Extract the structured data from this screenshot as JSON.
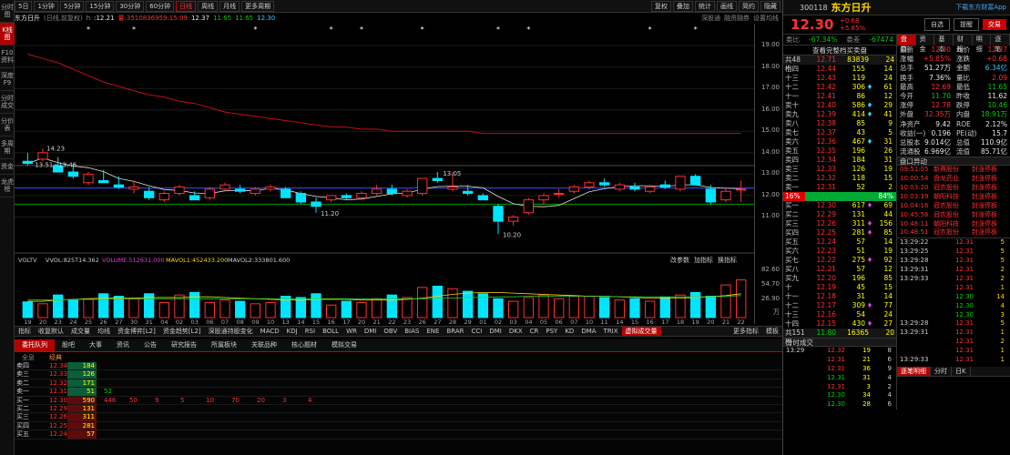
{
  "left_nav": [
    "分时图",
    "K线图",
    "F10资料",
    "深度F9",
    "分时成交",
    "分价表",
    "多周期",
    "资金",
    "龙虎榜"
  ],
  "left_nav_active": 1,
  "toolbar": {
    "periods": [
      "5日",
      "1分钟",
      "5分钟",
      "15分钟",
      "30分钟",
      "60分钟",
      "日线",
      "周线",
      "月线",
      "更多周期"
    ],
    "active": "日线",
    "right": [
      "复权",
      "叠加",
      "统计",
      "画线",
      "简约",
      "隐藏"
    ]
  },
  "info": {
    "name": "东方日升",
    "mode": "(日线,前复权)",
    "h": "h",
    "cursor": ":12.21",
    "vol": "量:3510836959:15:09",
    "c1": "12.37",
    "c2": "11.65",
    "c3": "11.65",
    "c4": "12.30",
    "links": [
      "深股通",
      "融资融券",
      "设置均线"
    ]
  },
  "price_axis": [
    "19.00",
    "18.00",
    "17.00",
    "16.00",
    "15.00",
    "14.00",
    "13.00",
    "12.00",
    "11.00"
  ],
  "vol_axis": [
    "82.60",
    "54.70",
    "26.90",
    "万"
  ],
  "chart_labels": {
    "max": "14.23",
    "ma_range": "13.51~13.46",
    "high2": "13.05",
    "low1": "11.20",
    "low2": "10.20"
  },
  "vol_header": {
    "a": "VOLTV",
    "b": "VVOL:825T14.362",
    "c": "VOLUME:512631.000",
    "d": "MAVOL1:452433.200",
    "e": "MAVOL2:333801.600",
    "right": [
      "改参数",
      "加指标",
      "换指标"
    ]
  },
  "date_ticks": [
    "19",
    "20",
    "23",
    "24",
    "25",
    "26",
    "27",
    "30",
    "31",
    "04",
    "02",
    "03",
    "06",
    "07",
    "08",
    "09",
    "10",
    "13",
    "14",
    "15",
    "16",
    "17",
    "20",
    "21",
    "22",
    "23",
    "26",
    "27",
    "28",
    "29",
    "01",
    "02",
    "03",
    "04",
    "05",
    "06",
    "07",
    "10",
    "11",
    "14",
    "15",
    "16",
    "17",
    "18",
    "19",
    "20",
    "21",
    "22"
  ],
  "indicators": [
    "指标",
    "收复默认",
    "成交量",
    "均线",
    "资金博弈[L2]",
    "资金趋势[L2]",
    "深股通持股变化",
    "MACD",
    "KDJ",
    "RSI",
    "BOLL",
    "WR",
    "DMI",
    "OBV",
    "BIAS",
    "ENE",
    "BRAR",
    "CCI",
    "DMI",
    "DKX",
    "CR",
    "PSY",
    "KD",
    "DMA",
    "TRIX",
    "虚拟成交量",
    "更多指标",
    "模板"
  ],
  "indicators_active": "虚拟成交量",
  "bottom_tabs": [
    "委托队列",
    "股吧",
    "大事",
    "资讯",
    "公告",
    "研究报告",
    "所属板块",
    "关联品种",
    "核心题材",
    "模拟交易"
  ],
  "queue_head": {
    "a": "全息",
    "b": "经典"
  },
  "queue": [
    {
      "l": "卖四",
      "p": "12.34",
      "v": "184",
      "c": "red",
      "o": []
    },
    {
      "l": "卖三",
      "p": "12.33",
      "v": "126",
      "c": "red",
      "o": []
    },
    {
      "l": "卖二",
      "p": "12.32",
      "v": "171",
      "c": "red",
      "o": []
    },
    {
      "l": "卖一",
      "p": "12.31",
      "v": "51",
      "c": "red",
      "o": [
        "52"
      ]
    },
    {
      "l": "买一",
      "p": "12.30",
      "v": "590",
      "c": "red",
      "o": [
        "446",
        "50",
        "9",
        "5",
        "10",
        "70",
        "20",
        "3",
        "4"
      ]
    },
    {
      "l": "买二",
      "p": "12.29",
      "v": "131",
      "c": "red",
      "o": []
    },
    {
      "l": "买三",
      "p": "12.26",
      "v": "311",
      "c": "red",
      "o": []
    },
    {
      "l": "买四",
      "p": "12.25",
      "v": "281",
      "c": "red",
      "o": []
    },
    {
      "l": "买五",
      "p": "12.24",
      "v": "57",
      "c": "red",
      "o": []
    }
  ],
  "stock": {
    "code": "300118",
    "name": "东方日升",
    "price": "12.30",
    "chg": "+0.68",
    "pct": "+5.85%",
    "btn1": "自选",
    "btn2": "提醒",
    "btn3": "交易",
    "ad": "下载东方财富App"
  },
  "weibi": {
    "k1": "委比",
    "v1": "-67.34%",
    "k2": "委差",
    "v2": "-67474"
  },
  "rtabs1": [
    "盘口",
    "资金",
    "基本",
    "财报",
    "明细",
    "逐笔"
  ],
  "orderbook_head": {
    "a": "查看完整档买卖盘",
    "b": "共48档",
    "c": "12.71",
    "d": "83839",
    "e": "24"
  },
  "asks": [
    {
      "l": "十四",
      "p": "12.44",
      "v": "155",
      "f": "",
      "n": "14"
    },
    {
      "l": "十三",
      "p": "12.43",
      "v": "119",
      "f": "",
      "n": "24"
    },
    {
      "l": "十二",
      "p": "12.42",
      "v": "306",
      "f": "♦",
      "n": "61"
    },
    {
      "l": "十一",
      "p": "12.41",
      "v": "86",
      "f": "",
      "n": "12"
    },
    {
      "l": "卖十",
      "p": "12.40",
      "v": "586",
      "f": "♦",
      "n": "29"
    },
    {
      "l": "卖九",
      "p": "12.39",
      "v": "414",
      "f": "♦",
      "n": "41"
    },
    {
      "l": "卖八",
      "p": "12.38",
      "v": "85",
      "f": "",
      "n": "9"
    },
    {
      "l": "卖七",
      "p": "12.37",
      "v": "43",
      "f": "",
      "n": "5"
    },
    {
      "l": "卖六",
      "p": "12.36",
      "v": "467",
      "f": "♦",
      "n": "31"
    },
    {
      "l": "卖五",
      "p": "12.35",
      "v": "196",
      "f": "",
      "n": "26"
    },
    {
      "l": "卖四",
      "p": "12.34",
      "v": "184",
      "f": "",
      "n": "31"
    },
    {
      "l": "卖三",
      "p": "12.33",
      "v": "126",
      "f": "",
      "n": "19"
    },
    {
      "l": "卖二",
      "p": "12.32",
      "v": "118",
      "f": "",
      "n": "15"
    },
    {
      "l": "卖一",
      "p": "12.31",
      "v": "52",
      "f": "",
      "n": "2"
    }
  ],
  "mid": {
    "pct": "16%",
    "label": "",
    "pct2": "84%"
  },
  "bids": [
    {
      "l": "买一",
      "p": "12.30",
      "v": "617",
      "f": "♦",
      "n": "69"
    },
    {
      "l": "买二",
      "p": "12.29",
      "v": "131",
      "f": "",
      "n": "44"
    },
    {
      "l": "买三",
      "p": "12.26",
      "v": "311",
      "f": "♦",
      "n": "156"
    },
    {
      "l": "买四",
      "p": "12.25",
      "v": "281",
      "f": "♦",
      "n": "85"
    },
    {
      "l": "买五",
      "p": "12.24",
      "v": "57",
      "f": "",
      "n": "14"
    },
    {
      "l": "买六",
      "p": "12.23",
      "v": "51",
      "f": "",
      "n": "19"
    },
    {
      "l": "买七",
      "p": "12.22",
      "v": "275",
      "f": "♦",
      "n": "92"
    },
    {
      "l": "买八",
      "p": "12.21",
      "v": "57",
      "f": "",
      "n": "12"
    },
    {
      "l": "买九",
      "p": "12.20",
      "v": "196",
      "f": "",
      "n": "85"
    },
    {
      "l": "十",
      "p": "12.19",
      "v": "45",
      "f": "",
      "n": "15"
    },
    {
      "l": "十一",
      "p": "12.18",
      "v": "31",
      "f": "",
      "n": "14"
    },
    {
      "l": "十二",
      "p": "12.17",
      "v": "309",
      "f": "♦",
      "n": "77"
    },
    {
      "l": "十三",
      "p": "12.16",
      "v": "54",
      "f": "",
      "n": "24"
    },
    {
      "l": "十四",
      "p": "12.15",
      "v": "430",
      "f": "♦",
      "n": "27"
    }
  ],
  "orderbook_foot": {
    "a": "共151档",
    "b": "11.80",
    "c": "16365",
    "d": "20"
  },
  "stats": [
    [
      "最新",
      "12.30",
      "red",
      "均价",
      "12.37",
      "red"
    ],
    [
      "涨幅",
      "+5.85%",
      "red",
      "涨跌",
      "+0.68",
      "red"
    ],
    [
      "总手",
      "51.27万",
      "wht",
      "金额",
      "6.34亿",
      "cyan"
    ],
    [
      "换手",
      "7.36%",
      "wht",
      "量比",
      "2.09",
      "red"
    ],
    [
      "最高",
      "12.69",
      "red",
      "最低",
      "11.65",
      "grn"
    ],
    [
      "今开",
      "11.70",
      "grn",
      "昨收",
      "11.62",
      "wht"
    ],
    [
      "涨停",
      "12.78",
      "red",
      "跌停",
      "10.46",
      "grn"
    ],
    [
      "外盘",
      "32.35万",
      "red",
      "内盘",
      "18.91万",
      "grn"
    ],
    [
      "净资产",
      "9.42",
      "wht",
      "ROE",
      "2.12%",
      "wht"
    ],
    [
      "收益(一)",
      "0.196",
      "wht",
      "PE(动)",
      "15.7",
      "wht"
    ],
    [
      "总股本",
      "9.014亿",
      "wht",
      "总值",
      "110.9亿",
      "wht"
    ],
    [
      "流通股",
      "6.969亿",
      "wht",
      "流值",
      "85.71亿",
      "wht"
    ]
  ],
  "movers_title": "盘口异动",
  "movers": [
    [
      "09:51:05",
      "新赛股份",
      "封涨停板"
    ],
    [
      "10:00:54",
      "盘龙药业",
      "封涨停板"
    ],
    [
      "10:03:20",
      "冠农股份",
      "封涨停板"
    ],
    [
      "10:03:39",
      "朝阳科技",
      "封涨停板"
    ],
    [
      "10:04:16",
      "冠农股份",
      "封涨停板"
    ],
    [
      "10:45:56",
      "冠农股份",
      "封涨停板"
    ],
    [
      "10:48:11",
      "朝阳科技",
      "封涨停板"
    ],
    [
      "10:48:51",
      "冠农股份",
      "封涨停板"
    ]
  ],
  "ticks_left_title": "分时成交",
  "ticks_left": [
    [
      "13:29",
      "12.32",
      "19",
      "8",
      "red"
    ],
    [
      "",
      "12.31",
      "21",
      "6",
      "red"
    ],
    [
      "",
      "12.31",
      "36",
      "9",
      "red"
    ],
    [
      "",
      "12.31",
      "31",
      "4",
      "grn"
    ],
    [
      "",
      "12.31",
      "3",
      "2",
      "red"
    ],
    [
      "",
      "12.30",
      "34",
      "4",
      "grn"
    ],
    [
      "",
      "12.30",
      "28",
      "6",
      "grn"
    ]
  ],
  "ticks_right": [
    [
      "13:29:22",
      "12.31",
      "5",
      "red"
    ],
    [
      "13:29:25",
      "12.31",
      "5",
      "red"
    ],
    [
      "13:29:28",
      "12.31",
      "5",
      "red"
    ],
    [
      "13:29:31",
      "12.31",
      "2",
      "red"
    ],
    [
      "13:29:33",
      "12.31",
      "2",
      "red"
    ],
    [
      "",
      "12.31",
      "1",
      "red"
    ],
    [
      "",
      "12.30",
      "14",
      "grn"
    ],
    [
      "",
      "12.30",
      "4",
      "grn"
    ],
    [
      "",
      "12.30",
      "3",
      "grn"
    ],
    [
      "13:29:28",
      "12.31",
      "5",
      "red"
    ],
    [
      "13:29:31",
      "12.31",
      "1",
      "red"
    ],
    [
      "",
      "12.31",
      "2",
      "red"
    ],
    [
      "",
      "12.31",
      "1",
      "red"
    ],
    [
      "13:29:33",
      "12.31",
      "1",
      "red"
    ]
  ],
  "rtabs2": [
    "逐笔明细",
    "分时",
    "日K"
  ],
  "chart_data": {
    "type": "candlestick",
    "price_range": [
      10.0,
      19.6
    ],
    "ma_long": [
      18.6,
      18.4,
      18.2,
      17.9,
      17.6,
      17.3,
      17.1,
      16.9,
      16.7,
      16.6,
      16.4,
      16.3,
      16.1,
      15.9,
      15.8,
      15.7,
      15.6,
      15.5,
      15.4,
      15.3,
      15.2,
      15.2,
      15.1,
      15.1,
      15.0,
      15.0,
      15.0,
      15.0,
      15.0,
      15.0,
      14.9,
      14.9,
      14.9,
      14.9,
      14.9,
      14.9,
      14.9,
      14.9,
      14.9,
      14.9,
      14.9,
      14.9,
      14.9,
      14.9,
      14.9,
      14.9,
      14.9,
      14.9
    ],
    "ohlc": [
      [
        13.6,
        14.0,
        13.4,
        13.5
      ],
      [
        13.7,
        14.2,
        13.6,
        14.0
      ],
      [
        13.4,
        13.8,
        13.1,
        13.1
      ],
      [
        13.1,
        13.5,
        12.8,
        12.9
      ],
      [
        12.6,
        13.1,
        12.5,
        13.0
      ],
      [
        12.7,
        13.2,
        12.6,
        12.6
      ],
      [
        12.5,
        12.9,
        12.3,
        12.4
      ],
      [
        12.3,
        12.7,
        12.1,
        12.4
      ],
      [
        12.2,
        12.4,
        11.8,
        11.9
      ],
      [
        11.8,
        12.2,
        11.7,
        12.1
      ],
      [
        12.1,
        12.5,
        12.0,
        12.4
      ],
      [
        12.0,
        12.2,
        11.8,
        11.8
      ],
      [
        11.9,
        12.4,
        11.8,
        12.3
      ],
      [
        12.3,
        12.6,
        12.2,
        12.5
      ],
      [
        12.3,
        12.5,
        12.1,
        12.2
      ],
      [
        12.1,
        12.4,
        12.0,
        12.3
      ],
      [
        12.3,
        12.5,
        12.2,
        12.4
      ],
      [
        12.3,
        12.4,
        11.9,
        11.9
      ],
      [
        12.1,
        12.2,
        11.6,
        11.7
      ],
      [
        11.7,
        11.9,
        11.2,
        11.5
      ],
      [
        11.8,
        12.0,
        11.7,
        12.0
      ],
      [
        12.0,
        12.1,
        11.8,
        11.9
      ],
      [
        11.9,
        12.2,
        11.8,
        12.1
      ],
      [
        12.1,
        12.5,
        12.0,
        12.3
      ],
      [
        12.3,
        12.5,
        12.0,
        12.1
      ],
      [
        12.0,
        12.3,
        11.9,
        12.2
      ],
      [
        12.1,
        12.8,
        12.0,
        12.8
      ],
      [
        12.8,
        13.1,
        12.6,
        12.7
      ],
      [
        12.3,
        13.1,
        12.2,
        12.4
      ],
      [
        12.2,
        12.5,
        12.0,
        12.1
      ],
      [
        12.0,
        12.1,
        11.8,
        11.8
      ],
      [
        11.5,
        11.6,
        10.2,
        10.8
      ],
      [
        10.8,
        11.1,
        10.6,
        11.0
      ],
      [
        11.2,
        11.9,
        11.1,
        11.8
      ],
      [
        11.8,
        12.1,
        11.6,
        12.0
      ],
      [
        12.1,
        12.3,
        11.9,
        12.1
      ],
      [
        12.2,
        12.5,
        12.1,
        12.4
      ],
      [
        12.4,
        12.7,
        12.3,
        12.6
      ],
      [
        12.6,
        12.8,
        12.4,
        12.5
      ],
      [
        12.3,
        12.6,
        12.2,
        12.5
      ],
      [
        12.4,
        12.6,
        12.2,
        12.3
      ],
      [
        12.2,
        12.5,
        12.1,
        12.4
      ],
      [
        12.5,
        12.7,
        12.3,
        12.4
      ],
      [
        12.3,
        12.9,
        12.2,
        12.9
      ],
      [
        12.9,
        13.0,
        12.5,
        12.5
      ],
      [
        12.3,
        12.5,
        11.6,
        11.7
      ],
      [
        11.8,
        12.3,
        11.7,
        12.2
      ],
      [
        12.3,
        12.7,
        11.7,
        12.3
      ]
    ],
    "volume": [
      25,
      22,
      36,
      28,
      30,
      38,
      34,
      30,
      38,
      24,
      36,
      40,
      24,
      28,
      26,
      22,
      24,
      34,
      32,
      38,
      20,
      26,
      24,
      30,
      36,
      32,
      48,
      50,
      46,
      42,
      38,
      30,
      26,
      32,
      36,
      30,
      34,
      34,
      32,
      28,
      30,
      26,
      32,
      36,
      40,
      34,
      52,
      60
    ],
    "mavol1": [
      26,
      26,
      28,
      29,
      30,
      31,
      31,
      31,
      32,
      32,
      32,
      33,
      33,
      32,
      31,
      30,
      29,
      28,
      28,
      29,
      29,
      29,
      28,
      28,
      28,
      29,
      31,
      34,
      37,
      39,
      40,
      40,
      39,
      38,
      37,
      36,
      35,
      34,
      34,
      33,
      32,
      31,
      31,
      31,
      32,
      33,
      35,
      38
    ],
    "mavol2": [
      28,
      28,
      28,
      29,
      29,
      29,
      30,
      30,
      30,
      30,
      30,
      30,
      30,
      30,
      30,
      30,
      30,
      30,
      30,
      30,
      30,
      30,
      30,
      30,
      30,
      30,
      30,
      31,
      31,
      32,
      32,
      33,
      33,
      34,
      34,
      34,
      34,
      34,
      34,
      33,
      33,
      33,
      33,
      33,
      33,
      33,
      34,
      35
    ]
  }
}
